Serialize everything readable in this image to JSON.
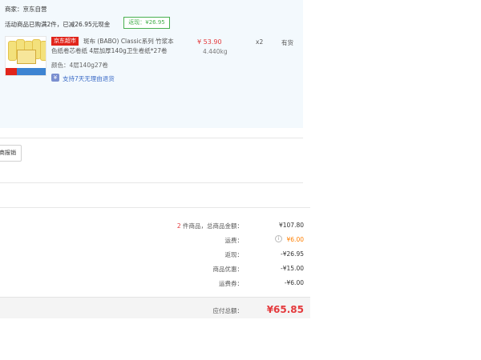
{
  "order": {
    "merchant": "商家：京东自营",
    "promo_text": "活动商品已购满2件，已减26.95元现金",
    "promo_tag": "返现：¥26.95"
  },
  "item": {
    "store_badge": "京东超市",
    "title": "斑布 (BABO) Classic系列 竹浆本色纸卷芯卷纸 4层加厚140g卫生卷纸*27卷",
    "price": "¥ 53.90",
    "weight": "4.440kg",
    "quantity": "x2",
    "stock": "有货",
    "color": "颜色：4层140g27卷",
    "return_policy": "支持7天无理由退货"
  },
  "report_button_label": "商报销",
  "summary": {
    "count": "2",
    "items_label": "件商品，总商品金额：",
    "items_value": "¥107.80",
    "shipping_label": "运费：",
    "shipping_value": "¥6.00",
    "cashback_label": "返现：",
    "cashback_value": "-¥26.95",
    "discount_label": "商品优惠：",
    "discount_value": "-¥15.00",
    "shipping_coupon_label": "运费券：",
    "shipping_coupon_value": "-¥6.00",
    "total_label": "应付总额：",
    "total_value": "¥65.85"
  },
  "colors": {
    "accent_red": "#e4393c",
    "promo_green": "#48b04f",
    "link_blue": "#3c6cc7",
    "panel_bg": "#f3f9fd"
  },
  "icons": {
    "info": "info-circle-icon",
    "return": "return-policy-icon"
  }
}
